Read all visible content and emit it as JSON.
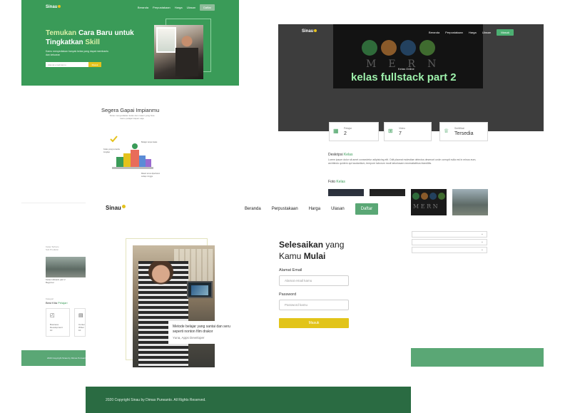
{
  "brand": "Sinau",
  "nav": [
    "Beranda",
    "Perpustakaan",
    "Harga",
    "Ulasan"
  ],
  "hero": {
    "headline_highlight": "Temukan",
    "headline_rest": " Cara Baru untuk Tingkatkan ",
    "headline_highlight2": "Skill",
    "daftar": "Daftar",
    "email_placeholder": "Alamat email kamu",
    "go": "Masuk",
    "subtitle": "Kamu menyediakan banyak kelas yang dapat membantu dan keluaran"
  },
  "section": {
    "title": "Segera Gapai Impianmu",
    "desc": "Sinau menyediakan kelas dan materi yang bisa kamu pelajari kapan saja",
    "note1": "Kelas yang tersedia lengkap",
    "note2": "Belajar tanpa batas",
    "note3": "Materi terus diperbarui setiap minggu"
  },
  "course": {
    "masuk": "Masuk",
    "kelas_online": "Kelas Online",
    "title": "kelas fullstack part 2",
    "stats": [
      {
        "label": "Pelajar",
        "value": "2",
        "icon": "building-icon"
      },
      {
        "label": "Video",
        "value": "7",
        "icon": "video-icon"
      },
      {
        "label": "Sertifikat",
        "value": "Tersedia",
        "icon": "trophy-icon"
      }
    ],
    "deskripsi_label": "Deskripsi ",
    "deskripsi_hl": "Kelas",
    "deskripsi_text": "Lorem ipsum dolor sit amet consectetur adipisicing elit. Odit placeat molestiae delectus deserunt unde corrupti nulla est in minus eum, architecto quidem qui laudantium, tempore laborum modi laboriosam necessitatibus blanditiis.",
    "foto_label": "Foto ",
    "foto_hl": "Kelas",
    "mern_letters": "MERN"
  },
  "partial": {
    "t1a": "Kelas Terbaru",
    "t1b": "Sub Produksi",
    "card_title": "Kelas fullstack part 2",
    "card_sub": "Beginner",
    "cat_label": "Kategori",
    "best_label": "Best Kita ",
    "best_hl": "Pelajari",
    "cards": [
      {
        "icon": "chat-icon",
        "text": "Business Development",
        "count": "10"
      },
      {
        "icon": "doc-icon",
        "text": "Content Writer",
        "count": "10"
      }
    ],
    "footer": "2020 Copyright Sinau by Dimas Purwanto"
  },
  "login": {
    "headline_hl1": "Selesaikan",
    "headline_rest1": " yang",
    "headline_rest2": "Kamu ",
    "headline_hl2": "Mulai",
    "email_label": "Alamat Email",
    "email_placeholder": "Alamat email kamu",
    "password_label": "Password",
    "password_placeholder": "Password kamu",
    "submit": "Masuk",
    "quote": "Metode belajar yang santai dan seru seperti nonton film drakor",
    "author": "Yuna, Apps Developer",
    "footer": "2020 Copyright Sinau by Dimas Purwanto. All Rights Reserved."
  },
  "colors": {
    "primary_green": "#3a9b58",
    "dark_green": "#2a6b42",
    "accent_yellow": "#e2c419",
    "dark_bg": "#3d3d3d"
  }
}
